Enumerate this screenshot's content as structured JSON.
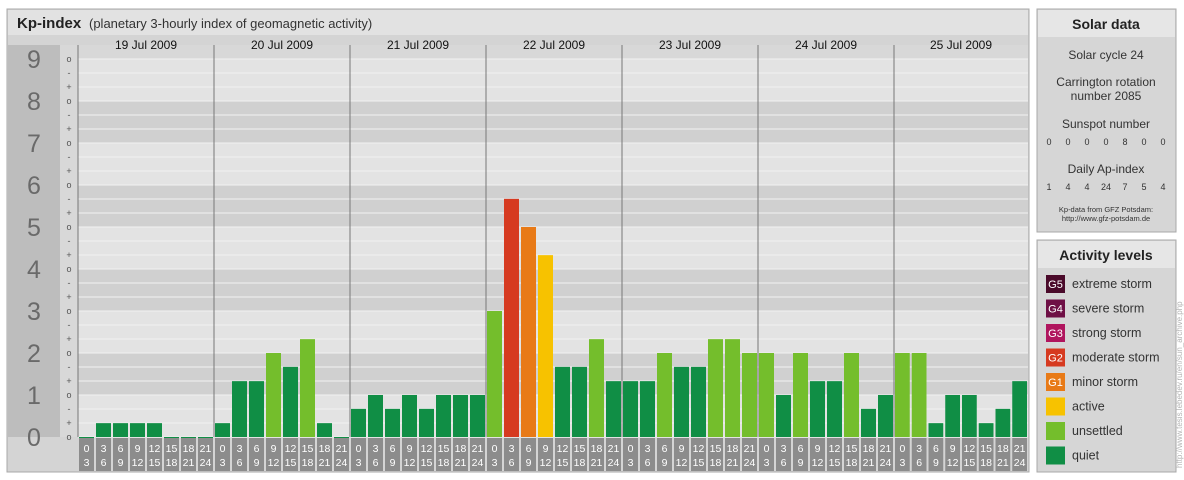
{
  "header": {
    "title": "Kp-index",
    "subtitle": "(planetary 3-hourly index of geomagnetic activity)"
  },
  "solar": {
    "heading": "Solar data",
    "cycle": "Solar cycle 24",
    "carrington_line1": "Carrington rotation",
    "carrington_line2": "number 2085",
    "sunspot_label": "Sunspot number",
    "sunspot_values": [
      "0",
      "0",
      "0",
      "0",
      "8",
      "0",
      "0"
    ],
    "ap_label": "Daily Ap-index",
    "ap_values": [
      "1",
      "4",
      "4",
      "24",
      "7",
      "5",
      "4"
    ],
    "credit_line1": "Kp-data from GFZ Potsdam:",
    "credit_line2": "http://www.gfz-potsdam.de"
  },
  "activity": {
    "heading": "Activity levels",
    "levels": [
      {
        "code": "G5",
        "label": "extreme storm",
        "color": "#4a0a2a"
      },
      {
        "code": "G4",
        "label": "severe storm",
        "color": "#6e0f45"
      },
      {
        "code": "G3",
        "label": "strong storm",
        "color": "#b0155e"
      },
      {
        "code": "G2",
        "label": "moderate storm",
        "color": "#d63a20"
      },
      {
        "code": "G1",
        "label": "minor storm",
        "color": "#e87a17"
      },
      {
        "code": "",
        "label": "active",
        "color": "#f7c200"
      },
      {
        "code": "",
        "label": "unsettled",
        "color": "#74be2c"
      },
      {
        "code": "",
        "label": "quiet",
        "color": "#108e45"
      }
    ]
  },
  "watermark": "http://www.tesis.lebedev.ru/en/sun_archive.php",
  "chart_data": {
    "type": "bar",
    "title": "Kp-index",
    "ylim": [
      0,
      9
    ],
    "y_ticks": [
      "0",
      "1",
      "2",
      "3",
      "4",
      "5",
      "6",
      "7",
      "8",
      "9"
    ],
    "minor_ticks": [
      "o",
      "+",
      "-"
    ],
    "days": [
      "19 Jul 2009",
      "20 Jul 2009",
      "21 Jul 2009",
      "22 Jul 2009",
      "23 Jul 2009",
      "24 Jul 2009",
      "25 Jul 2009"
    ],
    "interval_start": [
      "0",
      "3",
      "6",
      "9",
      "12",
      "15",
      "18",
      "21"
    ],
    "interval_end": [
      "3",
      "6",
      "9",
      "12",
      "15",
      "18",
      "21",
      "24"
    ],
    "values": [
      0.0,
      0.33,
      0.33,
      0.33,
      0.33,
      0.0,
      0.0,
      0.0,
      0.33,
      1.33,
      1.33,
      2.0,
      1.67,
      2.33,
      0.33,
      0.0,
      0.67,
      1.0,
      0.67,
      1.0,
      0.67,
      1.0,
      1.0,
      1.0,
      3.0,
      5.67,
      5.0,
      4.33,
      1.67,
      1.67,
      2.33,
      1.33,
      1.33,
      1.33,
      2.0,
      1.67,
      1.67,
      2.33,
      2.33,
      2.0,
      2.0,
      1.0,
      2.0,
      1.33,
      1.33,
      2.0,
      0.67,
      1.0,
      2.0,
      2.0,
      0.33,
      1.0,
      1.0,
      0.33,
      0.67,
      1.33
    ],
    "colors": {
      "quiet": "#108e45",
      "unsettled": "#74be2c",
      "active": "#f7c200",
      "g1": "#e87a17",
      "g2": "#d63a20",
      "g3": "#b0155e",
      "g4": "#6e0f45",
      "g5": "#4a0a2a"
    }
  }
}
